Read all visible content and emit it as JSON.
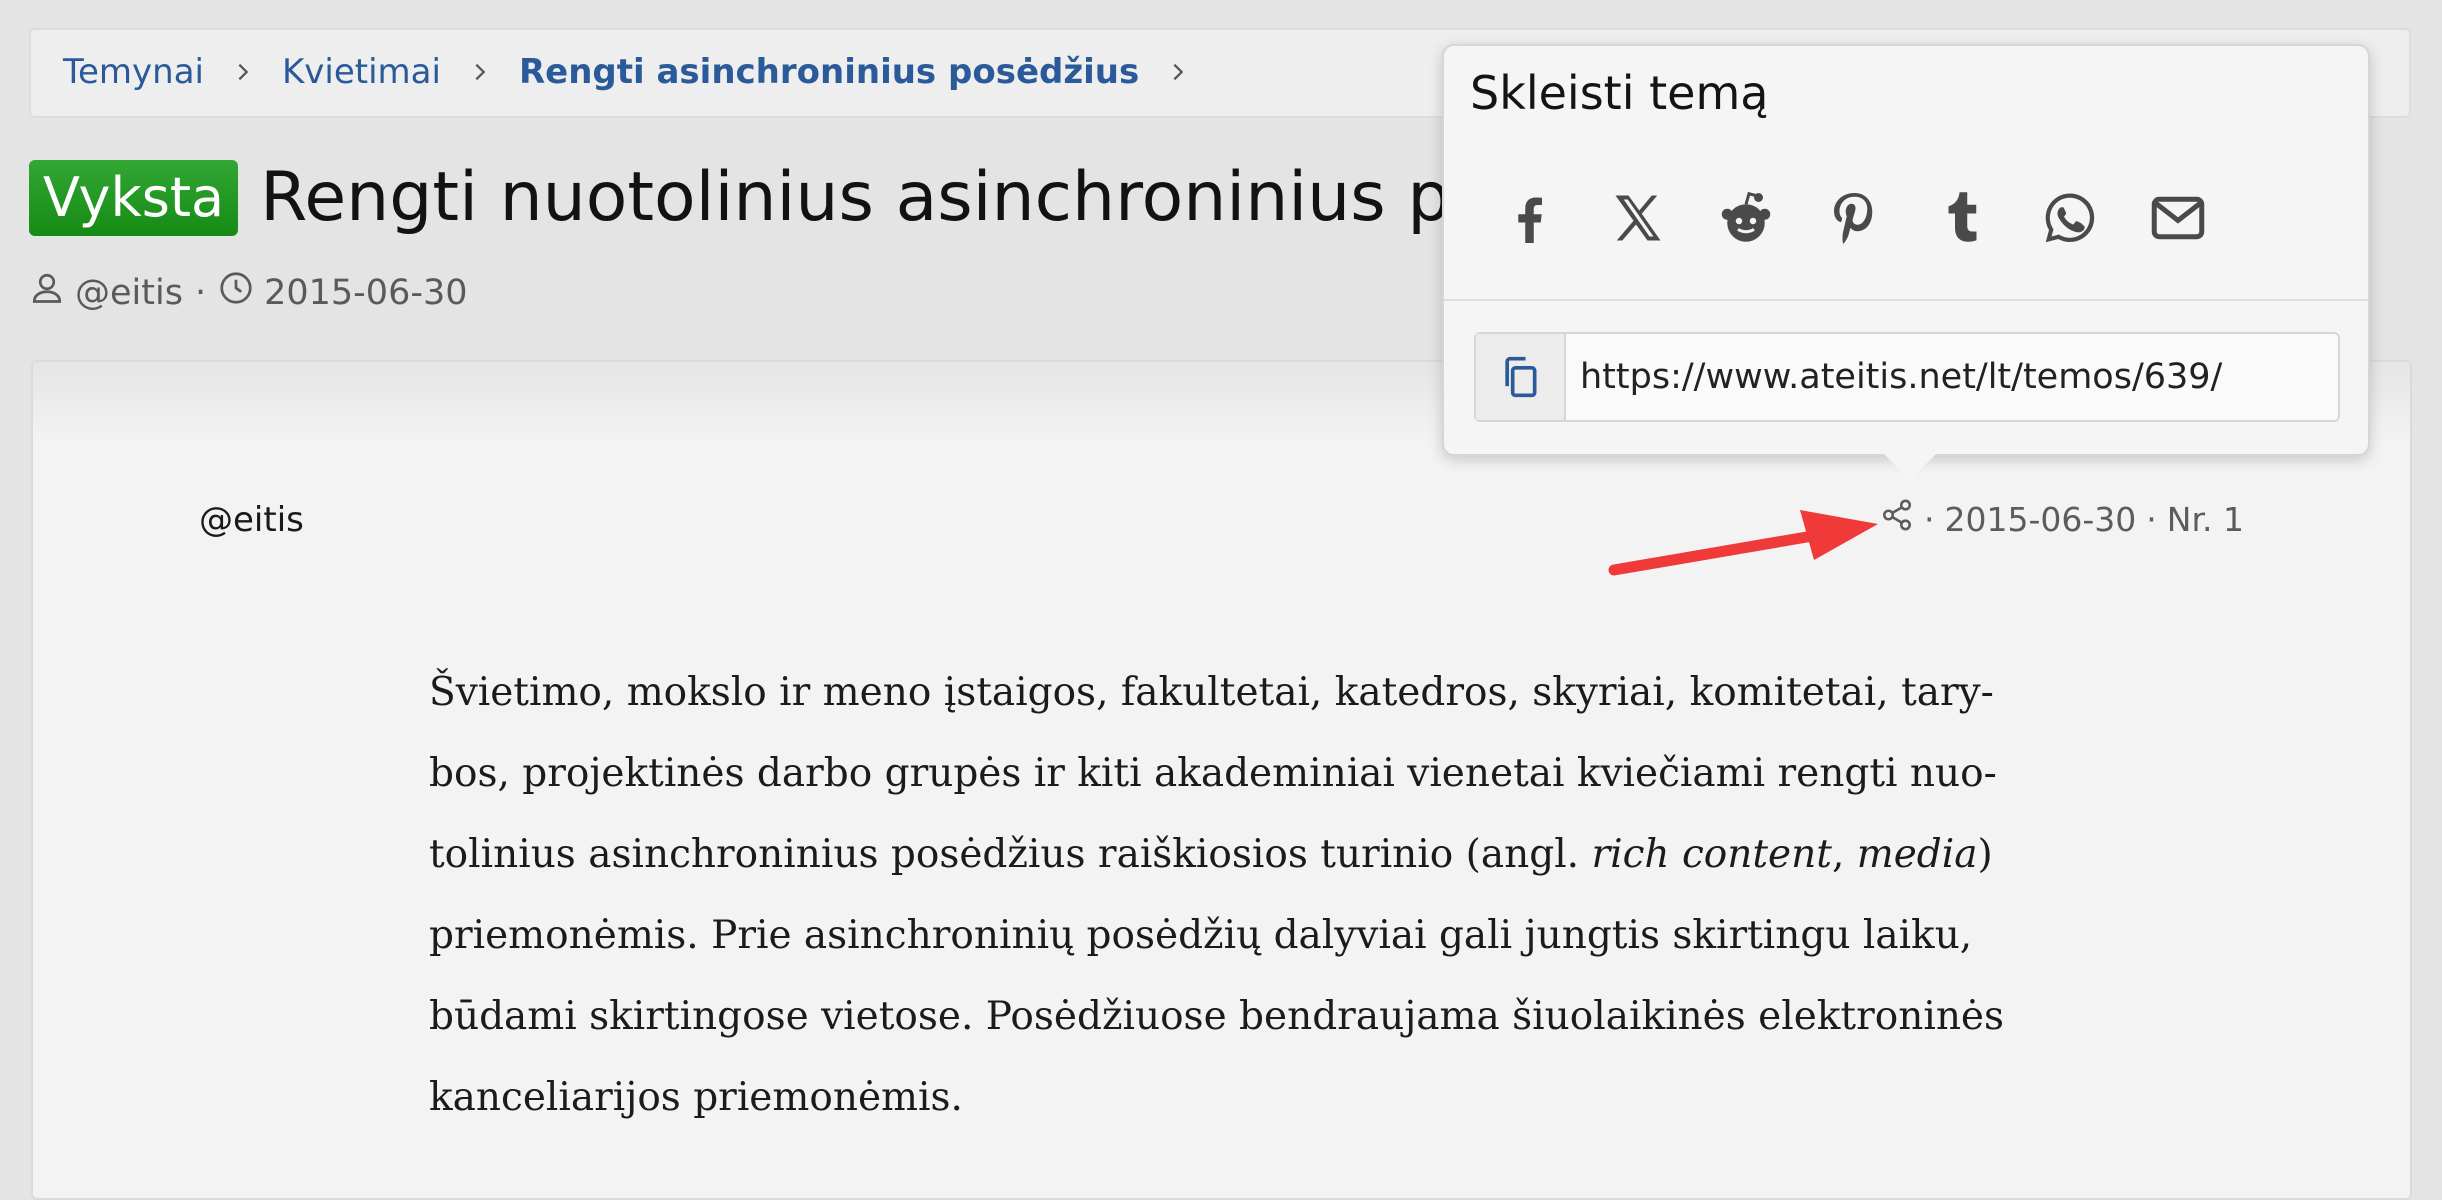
{
  "breadcrumb": {
    "items": [
      "Temynai",
      "Kvietimai",
      "Rengti asinchroninius posėdžius"
    ]
  },
  "thread": {
    "status_badge": "Vyksta",
    "title": "Rengti nuotolinius asinchroninius pos",
    "author": "@eitis",
    "date": "2015-06-30"
  },
  "post": {
    "author": "@eitis",
    "date": "2015-06-30",
    "number": "Nr. 1",
    "body_lines": [
      "Švietimo, mokslo ir meno įstaigos, fakultetai, katedros, skyriai, komitetai, tary-",
      "bos, projektinės darbo grupės ir kiti akademiniai vienetai kviečiami rengti nuo-",
      "tolinius asinchroninius posėdžius raiškiosios turinio (angl.",
      "rich content",
      "media",
      "priemonėmis. Prie asinchroninių posėdžių dalyviai gali jungtis skirtingu laiku,",
      "būdami skirtingose vietose. Posėdžiuose bendraujama šiuolaikinės elektroninės",
      "kanceliarijos priemonėmis."
    ]
  },
  "share_popup": {
    "title": "Skleisti temą",
    "icons": [
      "facebook-icon",
      "x-icon",
      "reddit-icon",
      "pinterest-icon",
      "tumblr-icon",
      "whatsapp-icon",
      "email-icon"
    ],
    "url": "https://www.ateitis.net/lt/temos/639/"
  },
  "colors": {
    "link": "#2a5a99",
    "badge": "#1f931f",
    "arrow": "#f03a3a"
  }
}
